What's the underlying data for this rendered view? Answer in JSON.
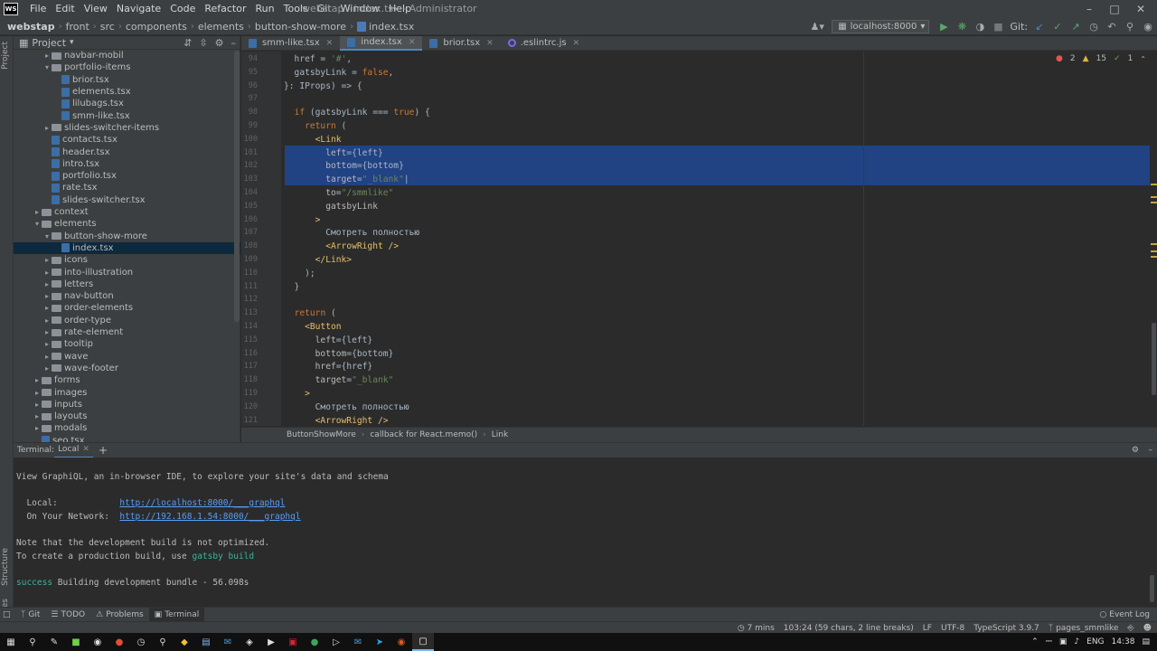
{
  "menu": [
    "File",
    "Edit",
    "View",
    "Navigate",
    "Code",
    "Refactor",
    "Run",
    "Tools",
    "Git",
    "Window",
    "Help"
  ],
  "window_title": "webstap - index.tsx - Administrator",
  "logo_text": "WS",
  "breadcrumb": {
    "root": "webstap",
    "items": [
      "front",
      "src",
      "components",
      "elements",
      "button-show-more"
    ],
    "file": "index.tsx"
  },
  "toolbar": {
    "run_config": "localhost:8000",
    "git_label": "Git:"
  },
  "project_panel": {
    "title": "Project",
    "rows": [
      {
        "label": "navbar-mobil",
        "kind": "folder",
        "indent": 4,
        "arrow": "▸"
      },
      {
        "label": "portfolio-items",
        "kind": "folder",
        "indent": 4,
        "arrow": "▾"
      },
      {
        "label": "brior.tsx",
        "kind": "file",
        "indent": 5,
        "arrow": ""
      },
      {
        "label": "elements.tsx",
        "kind": "file",
        "indent": 5,
        "arrow": ""
      },
      {
        "label": "lilubags.tsx",
        "kind": "file",
        "indent": 5,
        "arrow": ""
      },
      {
        "label": "smm-like.tsx",
        "kind": "file",
        "indent": 5,
        "arrow": ""
      },
      {
        "label": "slides-switcher-items",
        "kind": "folder",
        "indent": 4,
        "arrow": "▸"
      },
      {
        "label": "contacts.tsx",
        "kind": "file",
        "indent": 4,
        "arrow": ""
      },
      {
        "label": "header.tsx",
        "kind": "file",
        "indent": 4,
        "arrow": ""
      },
      {
        "label": "intro.tsx",
        "kind": "file",
        "indent": 4,
        "arrow": ""
      },
      {
        "label": "portfolio.tsx",
        "kind": "file",
        "indent": 4,
        "arrow": ""
      },
      {
        "label": "rate.tsx",
        "kind": "file",
        "indent": 4,
        "arrow": ""
      },
      {
        "label": "slides-switcher.tsx",
        "kind": "file",
        "indent": 4,
        "arrow": ""
      },
      {
        "label": "context",
        "kind": "folder",
        "indent": 3,
        "arrow": "▸"
      },
      {
        "label": "elements",
        "kind": "folder",
        "indent": 3,
        "arrow": "▾"
      },
      {
        "label": "button-show-more",
        "kind": "folder",
        "indent": 4,
        "arrow": "▾"
      },
      {
        "label": "index.tsx",
        "kind": "file",
        "indent": 5,
        "arrow": "",
        "selected": true
      },
      {
        "label": "icons",
        "kind": "folder",
        "indent": 4,
        "arrow": "▸"
      },
      {
        "label": "into-illustration",
        "kind": "folder",
        "indent": 4,
        "arrow": "▸"
      },
      {
        "label": "letters",
        "kind": "folder",
        "indent": 4,
        "arrow": "▸"
      },
      {
        "label": "nav-button",
        "kind": "folder",
        "indent": 4,
        "arrow": "▸"
      },
      {
        "label": "order-elements",
        "kind": "folder",
        "indent": 4,
        "arrow": "▸"
      },
      {
        "label": "order-type",
        "kind": "folder",
        "indent": 4,
        "arrow": "▸"
      },
      {
        "label": "rate-element",
        "kind": "folder",
        "indent": 4,
        "arrow": "▸"
      },
      {
        "label": "tooltip",
        "kind": "folder",
        "indent": 4,
        "arrow": "▸"
      },
      {
        "label": "wave",
        "kind": "folder",
        "indent": 4,
        "arrow": "▸"
      },
      {
        "label": "wave-footer",
        "kind": "folder",
        "indent": 4,
        "arrow": "▸"
      },
      {
        "label": "forms",
        "kind": "folder",
        "indent": 3,
        "arrow": "▸"
      },
      {
        "label": "images",
        "kind": "folder",
        "indent": 3,
        "arrow": "▸"
      },
      {
        "label": "inputs",
        "kind": "folder",
        "indent": 3,
        "arrow": "▸"
      },
      {
        "label": "layouts",
        "kind": "folder",
        "indent": 3,
        "arrow": "▸"
      },
      {
        "label": "modals",
        "kind": "folder",
        "indent": 3,
        "arrow": "▸"
      },
      {
        "label": "seo.tsx",
        "kind": "file",
        "indent": 3,
        "arrow": ""
      }
    ]
  },
  "editor_tabs": [
    {
      "label": "smm-like.tsx",
      "icon": "tsx"
    },
    {
      "label": "index.tsx",
      "icon": "tsx",
      "active": true
    },
    {
      "label": "brior.tsx",
      "icon": "tsx"
    },
    {
      "label": ".eslintrc.js",
      "icon": "eslint"
    }
  ],
  "inspections": {
    "errors": "2",
    "warnings": "15",
    "ok": "1"
  },
  "code": {
    "lines": [
      {
        "n": "94",
        "html": "  href = <span class='str'>'#'</span>,"
      },
      {
        "n": "95",
        "html": "  gatsbyLink = <span class='kw'>false</span>,"
      },
      {
        "n": "96",
        "html": "}: IProps) => {"
      },
      {
        "n": "97",
        "html": ""
      },
      {
        "n": "98",
        "html": "  <span class='kw'>if</span> (gatsbyLink === <span class='kw'>true</span>) {"
      },
      {
        "n": "99",
        "html": "    <span class='kw'>return</span> ("
      },
      {
        "n": "100",
        "html": "      <span class='tag'>&lt;Link</span>"
      },
      {
        "n": "101",
        "html": "        <span class='attr'>left</span>={left}"
      },
      {
        "n": "102",
        "html": "        <span class='attr'>bottom</span>={bottom}"
      },
      {
        "n": "103",
        "html": "        <span class='attr'>target</span>=<span class='str'>\"_blank\"</span>|"
      },
      {
        "n": "104",
        "html": "        <span class='attr'>to</span>=<span class='str'>\"/smmlike\"</span>"
      },
      {
        "n": "105",
        "html": "        <span class='attr'>gatsbyLink</span>"
      },
      {
        "n": "106",
        "html": "      <span class='tag'>&gt;</span>"
      },
      {
        "n": "107",
        "html": "        Смотреть полностью"
      },
      {
        "n": "108",
        "html": "        <span class='tag'>&lt;ArrowRight /&gt;</span>"
      },
      {
        "n": "109",
        "html": "      <span class='tag'>&lt;/Link&gt;</span>"
      },
      {
        "n": "110",
        "html": "    );"
      },
      {
        "n": "111",
        "html": "  }"
      },
      {
        "n": "112",
        "html": ""
      },
      {
        "n": "113",
        "html": "  <span class='kw'>return</span> ("
      },
      {
        "n": "114",
        "html": "    <span class='tag'>&lt;Button</span>"
      },
      {
        "n": "115",
        "html": "      <span class='attr'>left</span>={left}"
      },
      {
        "n": "116",
        "html": "      <span class='attr'>bottom</span>={bottom}"
      },
      {
        "n": "117",
        "html": "      <span class='attr'>href</span>={href}"
      },
      {
        "n": "118",
        "html": "      <span class='attr'>target</span>=<span class='str'>\"_blank\"</span>"
      },
      {
        "n": "119",
        "html": "    <span class='tag'>&gt;</span>"
      },
      {
        "n": "120",
        "html": "      Смотреть полностью"
      },
      {
        "n": "121",
        "html": "      <span class='tag'>&lt;ArrowRight /&gt;</span>"
      }
    ]
  },
  "editor_breadcrumbs": [
    "ButtonShowMore",
    "callback for React.memo()",
    "Link"
  ],
  "terminal": {
    "label": "Terminal:",
    "tab": "Local",
    "lines": [
      {
        "text": "View GraphiQL, an in-browser IDE, to explore your site's data and schema"
      },
      {
        "text": ""
      },
      {
        "text": "  Local:            ",
        "link": "http://localhost:8000/___graphql"
      },
      {
        "text": "  On Your Network:  ",
        "link": "http://192.168.1.54:8000/___graphql"
      },
      {
        "text": ""
      },
      {
        "text": "Note that the development build is not optimized."
      },
      {
        "text": "To create a production build, use ",
        "green": "gatsby build"
      },
      {
        "text": ""
      },
      {
        "green_prefix": "success",
        "text": " Building development bundle - 56.098s"
      }
    ]
  },
  "tool_tabs": [
    {
      "label": "Git",
      "icon": "branch"
    },
    {
      "label": "TODO",
      "icon": "list"
    },
    {
      "label": "Problems",
      "icon": "warning"
    },
    {
      "label": "Terminal",
      "icon": "terminal",
      "active": true
    }
  ],
  "event_log": "Event Log",
  "status": {
    "vcs_time": "7 mins",
    "position": "103:24 (59 chars, 2 line breaks)",
    "line_sep": "LF",
    "encoding": "UTF-8",
    "lang": "TypeScript 3.9.7",
    "branch": "pages_smmlike"
  },
  "stripe_labels": {
    "project": "Project",
    "structure": "Structure",
    "favorites": "Favorites"
  },
  "tray": {
    "lang": "ENG",
    "time": "14:38"
  }
}
